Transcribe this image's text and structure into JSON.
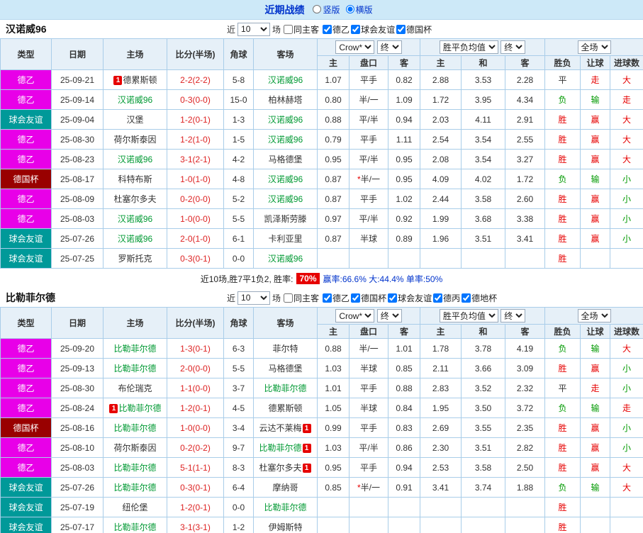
{
  "topbar": {
    "title": "近期战绩",
    "layout_options": [
      {
        "label": "竖版",
        "selected": false
      },
      {
        "label": "横版",
        "selected": true
      }
    ]
  },
  "colors": {
    "accent": "#0033cc",
    "win": "#e60000",
    "lose": "#009900",
    "draw": "#333333",
    "team_focus": "#009933",
    "score": "#dd2222",
    "badge": "#e60000",
    "league_colors": {
      "德乙": "#e800e8",
      "球会友谊": "#009999",
      "德国杯": "#990000"
    }
  },
  "columns": {
    "type": "类型",
    "date": "日期",
    "home": "主场",
    "score": "比分(半场)",
    "corner": "角球",
    "away": "客场",
    "odds": [
      "主",
      "盘口",
      "客"
    ],
    "avg": [
      "主",
      "和",
      "客"
    ],
    "result": [
      "胜负",
      "让球",
      "进球数"
    ]
  },
  "sections": [
    {
      "team": "汉诺威96",
      "controls": {
        "near_label": "近",
        "count_value": "10",
        "games_label": "场",
        "same_venue_label": "同主客",
        "same_venue_checked": false,
        "league_filters": [
          {
            "label": "德乙",
            "checked": true
          },
          {
            "label": "球会友谊",
            "checked": true
          },
          {
            "label": "德国杯",
            "checked": true
          }
        ],
        "odds_source": "Crow*",
        "odds_stage": "终",
        "avg_source": "胜平负均值",
        "avg_stage": "终",
        "scope": "全场"
      },
      "rows": [
        {
          "type": "德乙",
          "date": "25-09-21",
          "home": "德累斯顿",
          "home_badge": "1",
          "home_badge_pos": "before",
          "home_focus": false,
          "score": "2-2(2-2)",
          "corner": "5-8",
          "away": "汉诺威96",
          "away_focus": true,
          "odds": [
            "1.07",
            "平手",
            "0.82"
          ],
          "avg": [
            "2.88",
            "3.53",
            "2.28"
          ],
          "result": [
            "平",
            "走",
            "大"
          ]
        },
        {
          "type": "德乙",
          "date": "25-09-14",
          "home": "汉诺威96",
          "home_focus": true,
          "score": "0-3(0-0)",
          "corner": "15-0",
          "away": "柏林赫塔",
          "away_focus": false,
          "odds": [
            "0.80",
            "半/一",
            "1.09"
          ],
          "avg": [
            "1.72",
            "3.95",
            "4.34"
          ],
          "result": [
            "负",
            "输",
            "走"
          ]
        },
        {
          "type": "球会友谊",
          "date": "25-09-04",
          "home": "汉堡",
          "home_focus": false,
          "score": "1-2(0-1)",
          "corner": "1-3",
          "away": "汉诺威96",
          "away_focus": true,
          "odds": [
            "0.88",
            "平/半",
            "0.94"
          ],
          "avg": [
            "2.03",
            "4.11",
            "2.91"
          ],
          "result": [
            "胜",
            "赢",
            "大"
          ]
        },
        {
          "type": "德乙",
          "date": "25-08-30",
          "home": "荷尔斯泰因",
          "home_focus": false,
          "score": "1-2(1-0)",
          "corner": "1-5",
          "away": "汉诺威96",
          "away_focus": true,
          "odds": [
            "0.79",
            "平手",
            "1.11"
          ],
          "avg": [
            "2.54",
            "3.54",
            "2.55"
          ],
          "result": [
            "胜",
            "赢",
            "大"
          ]
        },
        {
          "type": "德乙",
          "date": "25-08-23",
          "home": "汉诺威96",
          "home_focus": true,
          "score": "3-1(2-1)",
          "corner": "4-2",
          "away": "马格德堡",
          "away_focus": false,
          "odds": [
            "0.95",
            "平/半",
            "0.95"
          ],
          "avg": [
            "2.08",
            "3.54",
            "3.27"
          ],
          "result": [
            "胜",
            "赢",
            "大"
          ]
        },
        {
          "type": "德国杯",
          "date": "25-08-17",
          "home": "科特布斯",
          "home_focus": false,
          "score": "1-0(1-0)",
          "corner": "4-8",
          "away": "汉诺威96",
          "away_focus": true,
          "odds": [
            "0.87",
            "*半/一",
            "0.95"
          ],
          "avg": [
            "4.09",
            "4.02",
            "1.72"
          ],
          "result": [
            "负",
            "输",
            "小"
          ]
        },
        {
          "type": "德乙",
          "date": "25-08-09",
          "home": "杜塞尔多夫",
          "home_focus": false,
          "score": "0-2(0-0)",
          "corner": "5-2",
          "away": "汉诺威96",
          "away_focus": true,
          "odds": [
            "0.87",
            "平手",
            "1.02"
          ],
          "avg": [
            "2.44",
            "3.58",
            "2.60"
          ],
          "result": [
            "胜",
            "赢",
            "小"
          ]
        },
        {
          "type": "德乙",
          "date": "25-08-03",
          "home": "汉诺威96",
          "home_focus": true,
          "score": "1-0(0-0)",
          "corner": "5-5",
          "away": "凯泽斯劳滕",
          "away_focus": false,
          "odds": [
            "0.97",
            "平/半",
            "0.92"
          ],
          "avg": [
            "1.99",
            "3.68",
            "3.38"
          ],
          "result": [
            "胜",
            "赢",
            "小"
          ]
        },
        {
          "type": "球会友谊",
          "date": "25-07-26",
          "home": "汉诺威96",
          "home_focus": true,
          "score": "2-0(1-0)",
          "corner": "6-1",
          "away": "卡利亚里",
          "away_focus": false,
          "odds": [
            "0.87",
            "半球",
            "0.89"
          ],
          "avg": [
            "1.96",
            "3.51",
            "3.41"
          ],
          "result": [
            "胜",
            "赢",
            "小"
          ]
        },
        {
          "type": "球会友谊",
          "date": "25-07-25",
          "home": "罗斯托克",
          "home_focus": false,
          "score": "0-3(0-1)",
          "corner": "0-0",
          "away": "汉诺威96",
          "away_focus": true,
          "odds": [
            "",
            "",
            ""
          ],
          "avg": [
            "",
            "",
            ""
          ],
          "result": [
            "胜",
            "",
            ""
          ]
        }
      ],
      "summary": {
        "prefix": "近10场,胜7平1负2, 胜率:",
        "win_rate": "70%",
        "stats": "赢率:66.6% 大:44.4% 单率:50%"
      }
    },
    {
      "team": "比勒菲尔德",
      "controls": {
        "near_label": "近",
        "count_value": "10",
        "games_label": "场",
        "same_venue_label": "同主客",
        "same_venue_checked": false,
        "league_filters": [
          {
            "label": "德乙",
            "checked": true
          },
          {
            "label": "德国杯",
            "checked": true
          },
          {
            "label": "球会友谊",
            "checked": true
          },
          {
            "label": "德丙",
            "checked": true
          },
          {
            "label": "德地杯",
            "checked": true
          }
        ],
        "odds_source": "Crow*",
        "odds_stage": "终",
        "avg_source": "胜平负均值",
        "avg_stage": "终",
        "scope": "全场"
      },
      "rows": [
        {
          "type": "德乙",
          "date": "25-09-20",
          "home": "比勒菲尔德",
          "home_focus": true,
          "score": "1-3(0-1)",
          "corner": "6-3",
          "away": "菲尔特",
          "away_focus": false,
          "odds": [
            "0.88",
            "半/一",
            "1.01"
          ],
          "avg": [
            "1.78",
            "3.78",
            "4.19"
          ],
          "result": [
            "负",
            "输",
            "大"
          ]
        },
        {
          "type": "德乙",
          "date": "25-09-13",
          "home": "比勒菲尔德",
          "home_focus": true,
          "score": "2-0(0-0)",
          "corner": "5-5",
          "away": "马格德堡",
          "away_focus": false,
          "odds": [
            "1.03",
            "半球",
            "0.85"
          ],
          "avg": [
            "2.11",
            "3.66",
            "3.09"
          ],
          "result": [
            "胜",
            "赢",
            "小"
          ]
        },
        {
          "type": "德乙",
          "date": "25-08-30",
          "home": "布伦瑞克",
          "home_focus": false,
          "score": "1-1(0-0)",
          "corner": "3-7",
          "away": "比勒菲尔德",
          "away_focus": true,
          "odds": [
            "1.01",
            "平手",
            "0.88"
          ],
          "avg": [
            "2.83",
            "3.52",
            "2.32"
          ],
          "result": [
            "平",
            "走",
            "小"
          ]
        },
        {
          "type": "德乙",
          "date": "25-08-24",
          "home": "比勒菲尔德",
          "home_focus": true,
          "home_badge": "1",
          "home_badge_pos": "before",
          "score": "1-2(0-1)",
          "corner": "4-5",
          "away": "德累斯顿",
          "away_focus": false,
          "odds": [
            "1.05",
            "半球",
            "0.84"
          ],
          "avg": [
            "1.95",
            "3.50",
            "3.72"
          ],
          "result": [
            "负",
            "输",
            "走"
          ]
        },
        {
          "type": "德国杯",
          "date": "25-08-16",
          "home": "比勒菲尔德",
          "home_focus": true,
          "score": "1-0(0-0)",
          "corner": "3-4",
          "away": "云达不莱梅",
          "away_focus": false,
          "away_badge": "1",
          "away_badge_pos": "after",
          "odds": [
            "0.99",
            "平手",
            "0.83"
          ],
          "avg": [
            "2.69",
            "3.55",
            "2.35"
          ],
          "result": [
            "胜",
            "赢",
            "小"
          ]
        },
        {
          "type": "德乙",
          "date": "25-08-10",
          "home": "荷尔斯泰因",
          "home_focus": false,
          "score": "0-2(0-2)",
          "corner": "9-7",
          "away": "比勒菲尔德",
          "away_focus": true,
          "away_badge": "1",
          "away_badge_pos": "after",
          "odds": [
            "1.03",
            "平/半",
            "0.86"
          ],
          "avg": [
            "2.30",
            "3.51",
            "2.82"
          ],
          "result": [
            "胜",
            "赢",
            "小"
          ]
        },
        {
          "type": "德乙",
          "date": "25-08-03",
          "home": "比勒菲尔德",
          "home_focus": true,
          "score": "5-1(1-1)",
          "corner": "8-3",
          "away": "杜塞尔多夫",
          "away_focus": false,
          "away_badge": "1",
          "away_badge_pos": "after",
          "odds": [
            "0.95",
            "平手",
            "0.94"
          ],
          "avg": [
            "2.53",
            "3.58",
            "2.50"
          ],
          "result": [
            "胜",
            "赢",
            "大"
          ]
        },
        {
          "type": "球会友谊",
          "date": "25-07-26",
          "home": "比勒菲尔德",
          "home_focus": true,
          "score": "0-3(0-1)",
          "corner": "6-4",
          "away": "摩纳哥",
          "away_focus": false,
          "odds": [
            "0.85",
            "*半/一",
            "0.91"
          ],
          "avg": [
            "3.41",
            "3.74",
            "1.88"
          ],
          "result": [
            "负",
            "输",
            "大"
          ]
        },
        {
          "type": "球会友谊",
          "date": "25-07-19",
          "home": "纽伦堡",
          "home_focus": false,
          "score": "1-2(0-1)",
          "corner": "0-0",
          "away": "比勒菲尔德",
          "away_focus": true,
          "odds": [
            "",
            "",
            ""
          ],
          "avg": [
            "",
            "",
            ""
          ],
          "result": [
            "胜",
            "",
            ""
          ]
        },
        {
          "type": "球会友谊",
          "date": "25-07-17",
          "home": "比勒菲尔德",
          "home_focus": true,
          "score": "3-1(3-1)",
          "corner": "1-2",
          "away": "伊姆斯特",
          "away_focus": false,
          "odds": [
            "",
            "",
            ""
          ],
          "avg": [
            "",
            "",
            ""
          ],
          "result": [
            "胜",
            "",
            ""
          ]
        }
      ]
    }
  ]
}
